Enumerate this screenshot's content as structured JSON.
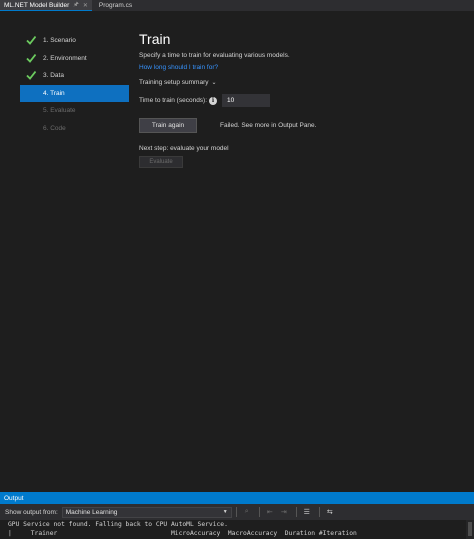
{
  "tabs": [
    {
      "label": "ML.NET Model Builder",
      "active": true,
      "icons": [
        "pin-icon",
        "close-icon"
      ]
    },
    {
      "label": "Program.cs",
      "active": false
    }
  ],
  "steps": [
    {
      "label": "1. Scenario",
      "state": "done"
    },
    {
      "label": "2. Environment",
      "state": "done"
    },
    {
      "label": "3. Data",
      "state": "done"
    },
    {
      "label": "4. Train",
      "state": "active"
    },
    {
      "label": "5. Evaluate",
      "state": "disabled"
    },
    {
      "label": "6. Code",
      "state": "disabled"
    }
  ],
  "train": {
    "title": "Train",
    "subtitle": "Specify a time to train for evaluating various models.",
    "link": "How long should I train for?",
    "summary_label": "Training setup summary",
    "time_label": "Time to train (seconds):",
    "time_value": "10",
    "train_button": "Train again",
    "status": "Failed. See more in Output Pane.",
    "next_step": "Next step: evaluate your model",
    "evaluate_button": "Evaluate"
  },
  "output": {
    "header": "Output",
    "show_from_label": "Show output from:",
    "source": "Machine Learning",
    "lines": [
      "GPU Service not found. Falling back to CPU AutoML Service.",
      "|     Trainer                              MicroAccuracy  MacroAccuracy  Duration #Iteration"
    ]
  },
  "colors": {
    "accent": "#007acc",
    "active_step": "#0e70c0",
    "check": "#6ccb5f",
    "link": "#3794ff"
  }
}
